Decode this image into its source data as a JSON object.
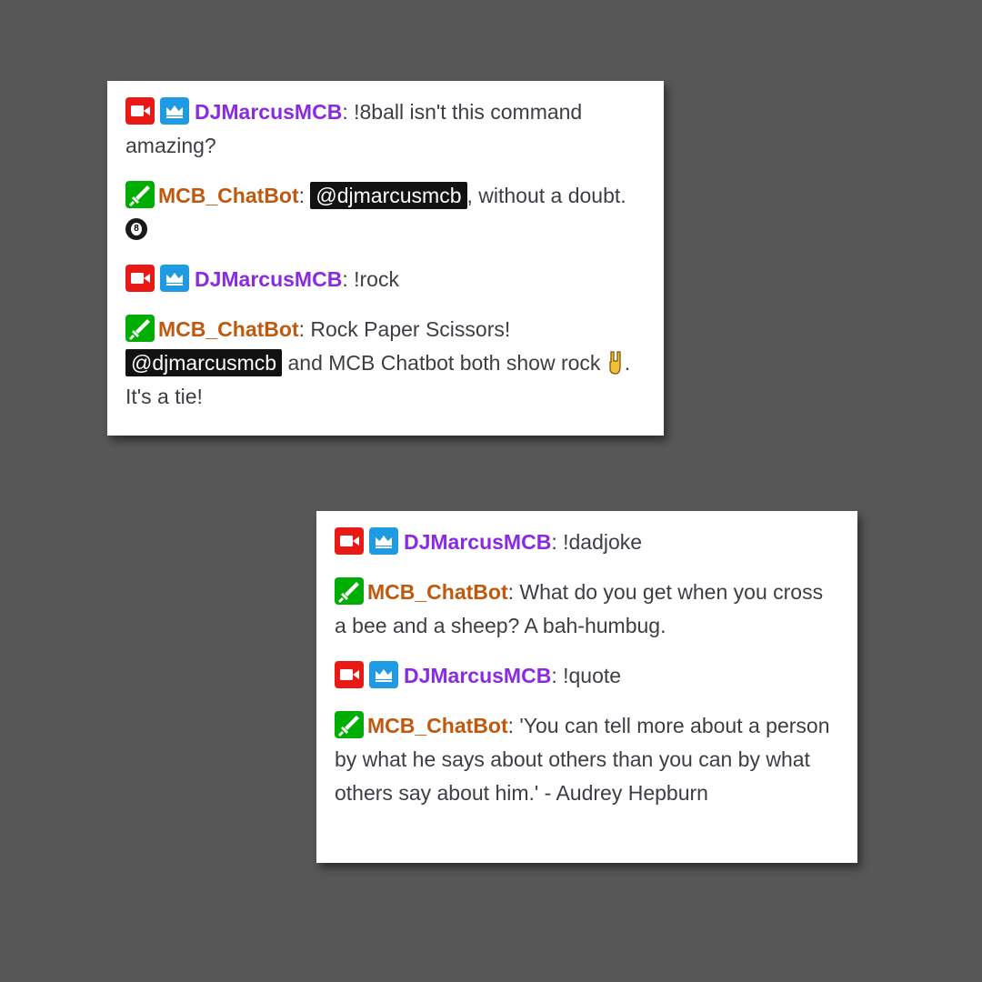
{
  "colors": {
    "background": "#575757",
    "broadcaster_badge": "#e91916",
    "subscriber_badge": "#1f9be3",
    "moderator_badge": "#00ad03",
    "djmarcus_name": "#8a2be2",
    "chatbot_name": "#c0580d",
    "mention_bg": "#121212"
  },
  "panels": [
    {
      "messages": [
        {
          "user": "DJMarcusMCB",
          "badges": [
            "broadcaster-icon",
            "subscriber-crown-icon"
          ],
          "text": "!8ball isn't this command amazing?"
        },
        {
          "user": "MCB_ChatBot",
          "badges": [
            "moderator-sword-icon"
          ],
          "mention": "@djmarcusmcb",
          "text_after": ", without a doubt.",
          "emoji": "8-ball-icon"
        },
        {
          "user": "DJMarcusMCB",
          "badges": [
            "broadcaster-icon",
            "subscriber-crown-icon"
          ],
          "text": "!rock"
        },
        {
          "user": "MCB_ChatBot",
          "badges": [
            "moderator-sword-icon"
          ],
          "text_before": "Rock Paper Scissors!",
          "mention": "@djmarcusmcb",
          "text_mid": "and MCB Chatbot both show rock",
          "emoji": "rock-hand-icon",
          "text_after": ". It's a tie!"
        }
      ]
    },
    {
      "messages": [
        {
          "user": "DJMarcusMCB",
          "badges": [
            "broadcaster-icon",
            "subscriber-crown-icon"
          ],
          "text": "!dadjoke"
        },
        {
          "user": "MCB_ChatBot",
          "badges": [
            "moderator-sword-icon"
          ],
          "text": "What do you get when you cross a bee and a sheep? A bah-humbug."
        },
        {
          "user": "DJMarcusMCB",
          "badges": [
            "broadcaster-icon",
            "subscriber-crown-icon"
          ],
          "text": "!quote"
        },
        {
          "user": "MCB_ChatBot",
          "badges": [
            "moderator-sword-icon"
          ],
          "text": "'You can tell more about a person by what he says about others than you can by what others say about him.' - Audrey Hepburn"
        }
      ]
    }
  ]
}
